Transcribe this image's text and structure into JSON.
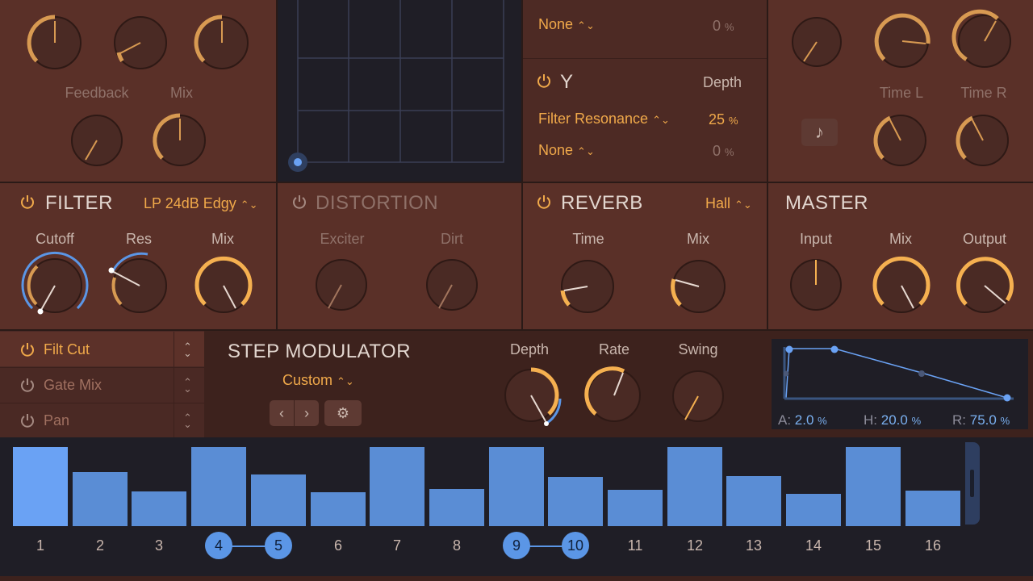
{
  "colors": {
    "accent_orange": "#f0a94a",
    "accent_blue": "#5b96e6",
    "panel": "#5a3028",
    "dark_bg": "#1f1e26"
  },
  "delay_top": {
    "feedback_label": "Feedback",
    "mix_label": "Mix"
  },
  "xy_mod": {
    "x_row2_source": "None",
    "x_row2_value": "0",
    "x_row2_unit": "%",
    "y_label": "Y",
    "depth_label": "Depth",
    "y_row1_source": "Filter Resonance",
    "y_row1_value": "25",
    "y_row1_unit": "%",
    "y_row2_source": "None",
    "y_row2_value": "0",
    "y_row2_unit": "%"
  },
  "delay_right": {
    "time_l_label": "Time L",
    "time_r_label": "Time R",
    "note_icon": "music-note-icon"
  },
  "filter": {
    "title": "FILTER",
    "mode": "LP 24dB Edgy",
    "cutoff_label": "Cutoff",
    "res_label": "Res",
    "mix_label": "Mix"
  },
  "distortion": {
    "title": "DISTORTION",
    "exciter_label": "Exciter",
    "dirt_label": "Dirt"
  },
  "reverb": {
    "title": "REVERB",
    "mode": "Hall",
    "time_label": "Time",
    "mix_label": "Mix"
  },
  "master": {
    "title": "MASTER",
    "input_label": "Input",
    "mix_label": "Mix",
    "output_label": "Output"
  },
  "mod_targets": [
    {
      "label": "Filt Cut"
    },
    {
      "label": "Gate Mix"
    },
    {
      "label": "Pan"
    }
  ],
  "step_mod": {
    "title": "STEP MODULATOR",
    "preset": "Custom",
    "depth_label": "Depth",
    "rate_label": "Rate",
    "swing_label": "Swing"
  },
  "envelope": {
    "a_label": "A:",
    "a_value": "2.0",
    "a_unit": "%",
    "h_label": "H:",
    "h_value": "20.0",
    "h_unit": "%",
    "r_label": "R:",
    "r_value": "75.0",
    "r_unit": "%"
  },
  "steps": {
    "labels": [
      "1",
      "2",
      "3",
      "4",
      "5",
      "6",
      "7",
      "8",
      "9",
      "10",
      "11",
      "12",
      "13",
      "14",
      "15",
      "16"
    ],
    "values": [
      1.0,
      0.68,
      0.44,
      1.0,
      0.65,
      0.43,
      1.0,
      0.47,
      1.0,
      0.62,
      0.46,
      1.0,
      0.63,
      0.41,
      1.0,
      0.45
    ]
  }
}
